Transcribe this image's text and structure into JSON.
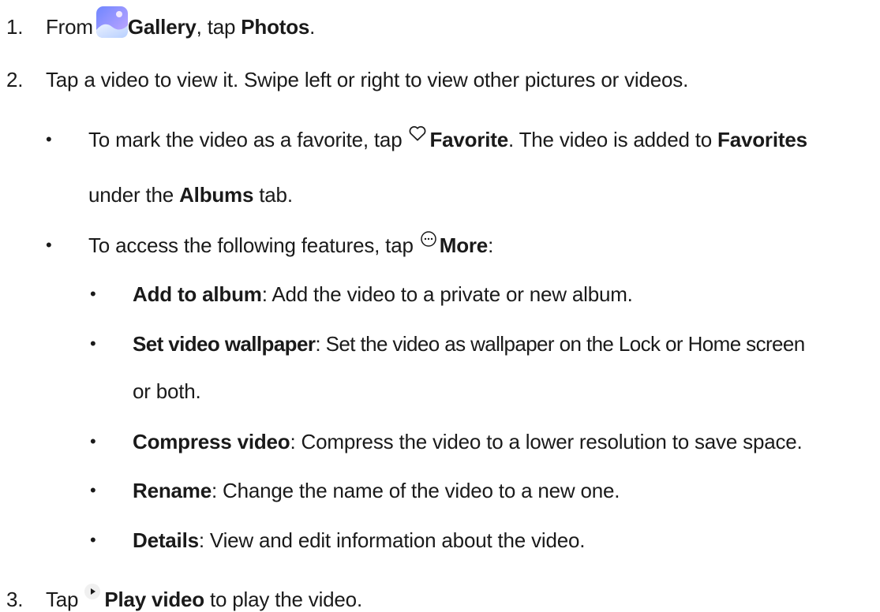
{
  "steps": [
    {
      "number": "1.",
      "prefix": "From",
      "icon": "gallery-icon",
      "app_name": "Gallery",
      "middle": ", tap ",
      "target": "Photos",
      "suffix": "."
    },
    {
      "number": "2.",
      "text": "Tap a video to view it. Swipe left or right to view other pictures or videos.",
      "bullets": [
        {
          "prefix": "To mark the video as a favorite, tap ",
          "icon": "heart-icon",
          "action": "Favorite",
          "middle": ". The video is added to ",
          "target": "Favorites",
          "line2_prefix": "under the ",
          "line2_bold": "Albums",
          "line2_suffix": " tab."
        },
        {
          "prefix": "To access the following features, tap ",
          "icon": "more-icon",
          "action": "More",
          "suffix": ":",
          "sub_bullets": [
            {
              "term": "Add to album",
              "desc": ": Add the video to a private or new album."
            },
            {
              "term": "Set video wallpaper",
              "desc": ": Set the video as wallpaper on the Lock or Home screen",
              "desc2": "or both."
            },
            {
              "term": "Compress video",
              "desc": ": Compress the video to a lower resolution to save space."
            },
            {
              "term": "Rename",
              "desc": ": Change the name of the video to a new one."
            },
            {
              "term": "Details",
              "desc": ": View and edit information about the video."
            }
          ]
        }
      ]
    },
    {
      "number": "3.",
      "prefix": "Tap ",
      "icon": "play-icon",
      "action": "Play video",
      "suffix": " to play the video."
    }
  ],
  "bullet_char": "•",
  "colors": {
    "text": "#1a1a1a",
    "gallery_gradient_start": "#7b8cff",
    "gallery_gradient_end": "#c9b6ff"
  }
}
